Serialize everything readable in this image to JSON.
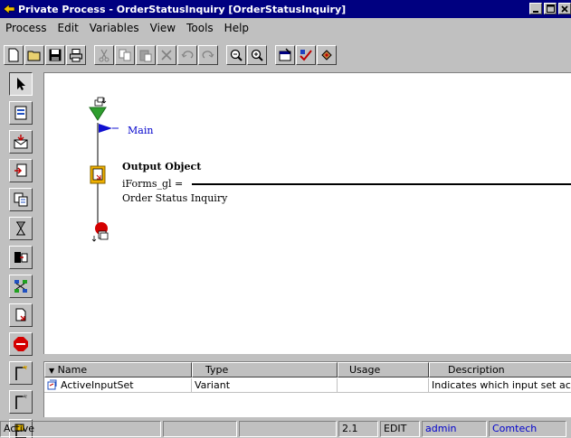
{
  "window": {
    "title": "Private Process - OrderStatusInquiry [OrderStatusInquiry]"
  },
  "menu": [
    "Process",
    "Edit",
    "Variables",
    "View",
    "Tools",
    "Help"
  ],
  "toolbar_icons": [
    "new-icon",
    "open-icon",
    "save-icon",
    "print-icon",
    "cut-icon",
    "copy-icon",
    "paste-icon",
    "delete-icon",
    "undo-icon",
    "redo-icon",
    "zoom-out-icon",
    "zoom-in-icon",
    "properties-icon",
    "validate-icon",
    "compile-icon"
  ],
  "palette_icons": [
    "pointer-icon",
    "form-icon",
    "mail-icon",
    "output-icon",
    "transform-icon",
    "hourglass-icon",
    "transfer-icon",
    "flow-icon",
    "action-icon",
    "stop-icon",
    "branch-icon",
    "branch-alt-icon",
    "decision-icon"
  ],
  "canvas": {
    "main_label": "Main",
    "node_title": "Output Object",
    "node_line1": "iForms_gl =",
    "node_line2": "Order Status Inquiry"
  },
  "grid": {
    "columns": [
      "Name",
      "Type",
      "Usage",
      "Description"
    ],
    "rows": [
      {
        "name": "ActiveInputSet",
        "type": "Variant",
        "usage": "",
        "description": "Indicates which input set ac..."
      }
    ]
  },
  "status": {
    "state": "Active",
    "p2": "",
    "p3": "",
    "version": "2.1",
    "mode": "EDIT",
    "user": "admin",
    "company": "Comtech"
  },
  "colors": {
    "title_bg": "#000080",
    "link_blue": "#0000cc",
    "start_green": "#2e9e2e",
    "stop_red": "#d40000"
  }
}
